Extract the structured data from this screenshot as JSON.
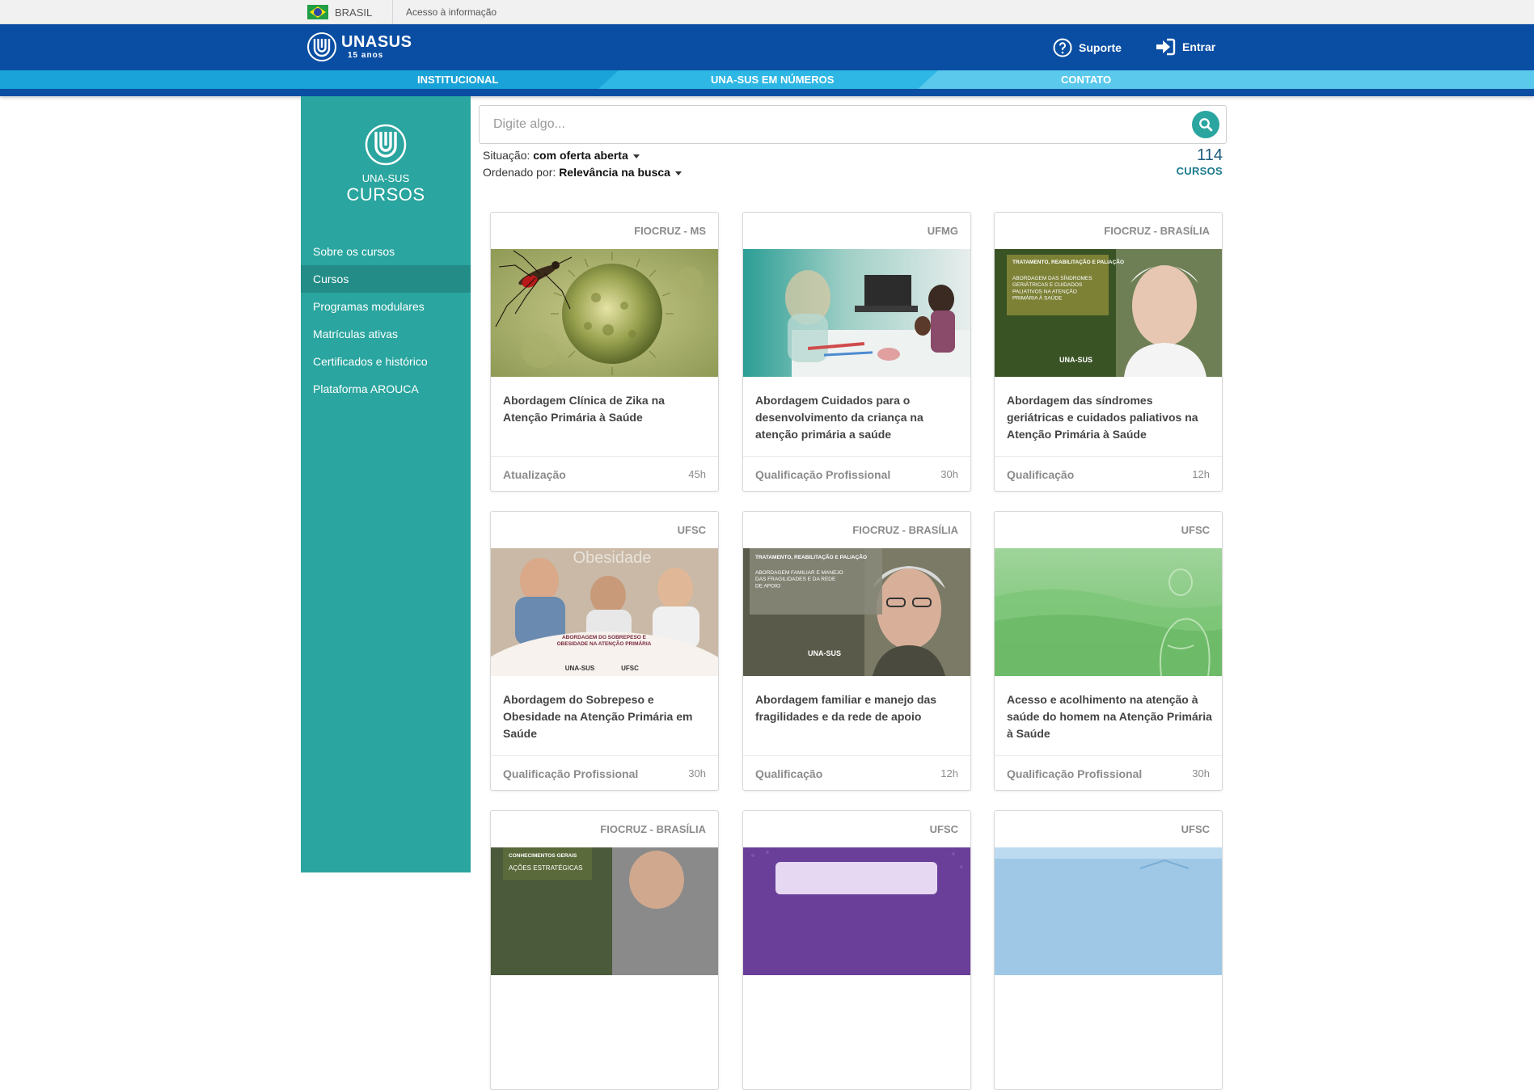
{
  "gov_bar": {
    "country": "BRASIL",
    "access_info": "Acesso à informação"
  },
  "header": {
    "logo_name": "UNASUS",
    "logo_sub": "15 anos",
    "support": "Suporte",
    "login": "Entrar",
    "colors": {
      "primary": "#0a4ea3",
      "nav": "#1aa3d8",
      "teal": "#2aa59f"
    }
  },
  "nav": {
    "items": [
      "INSTITUCIONAL",
      "UNA-SUS EM NÚMEROS",
      "CONTATO"
    ]
  },
  "sidebar": {
    "logo_small": "UNA-SUS",
    "logo_big": "CURSOS",
    "items": [
      "Sobre os cursos",
      "Cursos",
      "Programas modulares",
      "Matrículas ativas",
      "Certificados e histórico",
      "Plataforma AROUCA"
    ],
    "active_index": 1
  },
  "search": {
    "placeholder": "Digite algo..."
  },
  "filters": {
    "situation_label": "Situação:",
    "situation_value": "com oferta aberta",
    "order_label": "Ordenado por:",
    "order_value": "Relevância na busca"
  },
  "results": {
    "count": "114",
    "label": "CURSOS"
  },
  "cards": [
    {
      "institution": "FIOCRUZ - MS",
      "title": "Abordagem Clínica de Zika na Atenção Primária à Saúde",
      "type": "Atualização",
      "hours": "45h",
      "image": "zika-mosquito-virus"
    },
    {
      "institution": "UFMG",
      "title": "Abordagem Cuidados para o desenvolvimento da criança na atenção primária a saúde",
      "type": "Qualificação Profissional",
      "hours": "30h",
      "image": "child-care-table"
    },
    {
      "institution": "FIOCRUZ - BRASÍLIA",
      "title": "Abordagem das síndromes geriátricas e cuidados paliativos na Atenção Primária à Saúde",
      "type": "Qualificação",
      "hours": "12h",
      "image": "elderly-man-portrait",
      "image_text": {
        "tag": "TRATAMENTO, REABILITAÇÃO E PALIAÇÃO",
        "heading": "ABORDAGEM DAS SÍNDROMES GERIÁTRICAS E CUIDADOS PALIATIVOS NA ATENÇÃO PRIMÁRIA À SAÚDE",
        "logo": "UNA-SUS"
      }
    },
    {
      "institution": "UFSC",
      "title": "Abordagem do Sobrepeso e Obesidade na Atenção Primária em Saúde",
      "type": "Qualificação Profissional",
      "hours": "30h",
      "image": "doctors-group-obesity",
      "image_text": {
        "word": "Obesidade",
        "heading": "ABORDAGEM DO SOBREPESO E OBESIDADE NA ATENÇÃO PRIMÁRIA",
        "logo1": "UNA-SUS",
        "logo2": "UFSC"
      }
    },
    {
      "institution": "FIOCRUZ - BRASÍLIA",
      "title": "Abordagem familiar e manejo das fragilidades e da rede de apoio",
      "type": "Qualificação",
      "hours": "12h",
      "image": "elderly-woman-portrait",
      "image_text": {
        "tag": "TRATAMENTO, REABILITAÇÃO E PALIAÇÃO",
        "heading": "ABORDAGEM FAMILIAR E MANEJO DAS FRAGILIDADES E DA REDE DE APOIO",
        "logo": "UNA-SUS"
      }
    },
    {
      "institution": "UFSC",
      "title": "Acesso e acolhimento na atenção à saúde do homem na Atenção Primária à Saúde",
      "type": "Qualificação Profissional",
      "hours": "30h",
      "image": "green-man-silhouette"
    },
    {
      "institution": "FIOCRUZ - BRASÍLIA",
      "image": "elderly-portrait-dark",
      "image_text": {
        "tag": "CONHECIMENTOS GERAIS",
        "heading": "AÇÕES ESTRATÉGICAS"
      }
    },
    {
      "institution": "UFSC",
      "image": "purple-banner"
    },
    {
      "institution": "UFSC",
      "image": "light-blue-banner"
    }
  ]
}
